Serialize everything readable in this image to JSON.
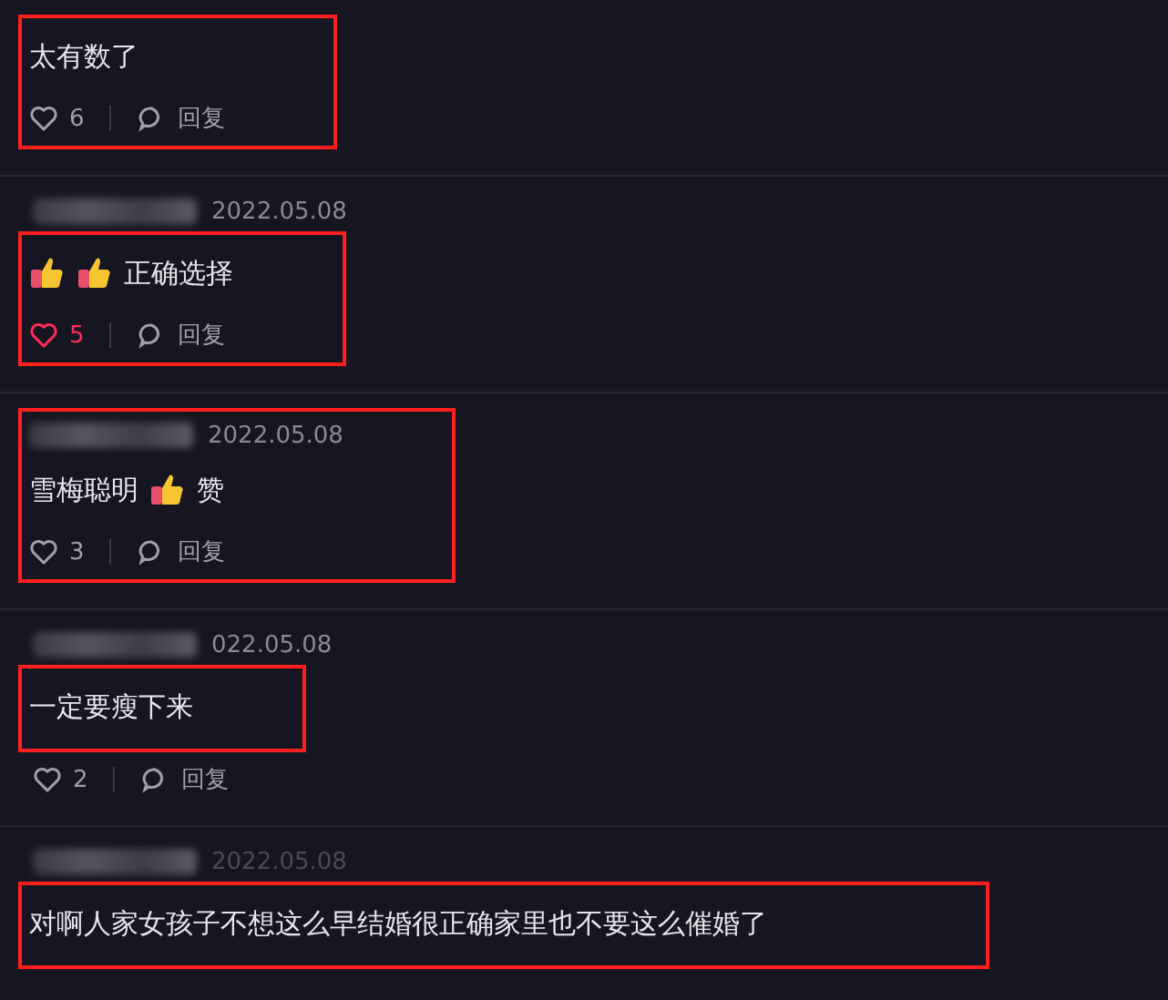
{
  "comments": [
    {
      "content": [
        {
          "kind": "text",
          "text": "太有数了"
        }
      ],
      "likes": "6",
      "liked": false,
      "reply": "回复",
      "highlight": {
        "kind": "body"
      }
    },
    {
      "date": "2022.05.08",
      "content": [
        {
          "kind": "thumb"
        },
        {
          "kind": "thumb"
        },
        {
          "kind": "text",
          "text": "正确选择"
        }
      ],
      "likes": "5",
      "liked": true,
      "reply": "回复",
      "highlight": {
        "kind": "body"
      }
    },
    {
      "date": "2022.05.08",
      "content": [
        {
          "kind": "text",
          "text": "雪梅聪明"
        },
        {
          "kind": "thumb"
        },
        {
          "kind": "text",
          "text": "赞"
        }
      ],
      "likes": "3",
      "liked": false,
      "reply": "回复",
      "highlight": {
        "kind": "all"
      }
    },
    {
      "date": "022.05.08",
      "content": [
        {
          "kind": "text",
          "text": "一定要瘦下来"
        }
      ],
      "likes": "2",
      "liked": false,
      "reply": "回复",
      "highlight": {
        "kind": "text"
      }
    },
    {
      "date": "2022.05.08",
      "content": [
        {
          "kind": "text",
          "text": "对啊人家女孩子不想这么早结婚很正确家里也不要这么催婚了"
        }
      ],
      "highlight": {
        "kind": "text"
      }
    }
  ]
}
